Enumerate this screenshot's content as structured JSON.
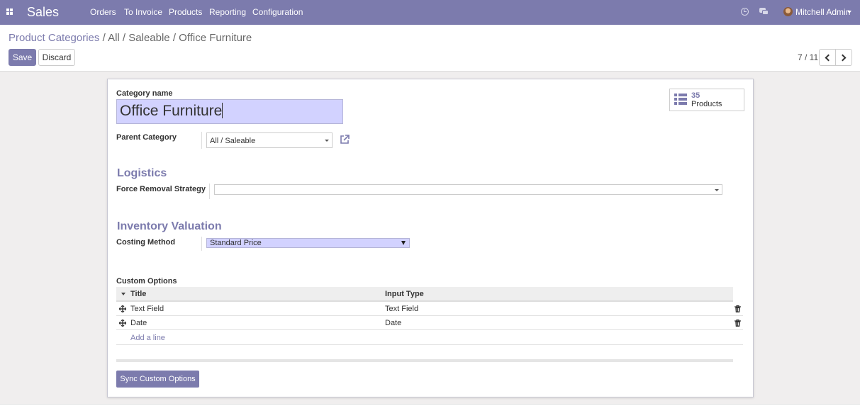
{
  "navbar": {
    "app_name": "Sales",
    "menu": [
      "Orders",
      "To Invoice",
      "Products",
      "Reporting",
      "Configuration"
    ],
    "user_name": "Mitchell Admin",
    "icons": [
      "apps-icon",
      "clock-icon",
      "chat-icon",
      "avatar",
      "caret-down-icon"
    ]
  },
  "breadcrumb": {
    "root": "Product Categories",
    "separator": " / ",
    "current": "All / Saleable / Office Furniture"
  },
  "toolbar": {
    "save_label": "Save",
    "discard_label": "Discard"
  },
  "pager": {
    "value": "7 / 11"
  },
  "form": {
    "category_name_label": "Category name",
    "category_name_value": "Office Furniture",
    "stat_button": {
      "value": "35",
      "label": "Products"
    },
    "parent_category_label": "Parent Category",
    "parent_category_value": "All / Saleable",
    "logistics_title": "Logistics",
    "removal_strategy_label": "Force Removal Strategy",
    "removal_strategy_value": "",
    "inventory_title": "Inventory Valuation",
    "costing_method_label": "Costing Method",
    "costing_method_value": "Standard Price",
    "custom_options_label": "Custom Options",
    "table": {
      "columns": [
        "Title",
        "Input Type"
      ],
      "rows": [
        [
          "Text Field",
          "Text Field"
        ],
        [
          "Date",
          "Date"
        ]
      ],
      "add_line_label": "Add a line"
    },
    "sync_button_label": "Sync Custom Options"
  },
  "colors": {
    "brand": "#7c7bad",
    "required_field_bg": "#d2d2ff",
    "background": "#f0eeee"
  }
}
